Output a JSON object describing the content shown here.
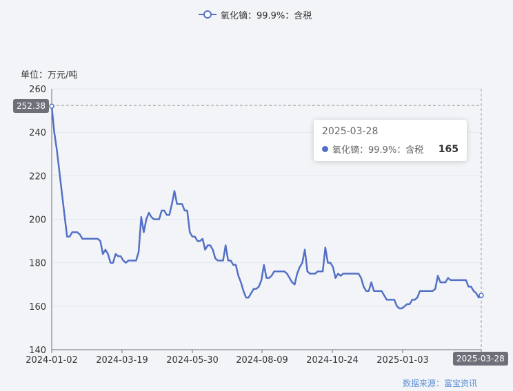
{
  "legend": {
    "label": "氧化镝：99.9%：含税"
  },
  "unit_label": "单位：万元/吨",
  "tooltip": {
    "date": "2025-03-28",
    "series": "氧化镝：99.9%：含税",
    "value": "165"
  },
  "crosshair": {
    "y_label": "252.38",
    "x_label": "2025-03-28"
  },
  "source": "数据来源：富宝资讯",
  "colors": {
    "line": "#5470c6",
    "grid": "#e0e6f1",
    "axis": "#6e7079"
  },
  "chart_data": {
    "type": "line",
    "ylim": [
      140,
      260
    ],
    "yticks": [
      140,
      160,
      180,
      200,
      220,
      240,
      260
    ],
    "x_ticks": [
      "2024-01-02",
      "2024-03-19",
      "2024-05-30",
      "2024-08-09",
      "2024-10-24",
      "2025-01-03",
      "2025-03-28"
    ],
    "series": [
      {
        "name": "氧化镝：99.9%：含税",
        "values": [
          252,
          240,
          232,
          222,
          212,
          202,
          192,
          192,
          194,
          194,
          194,
          193,
          191,
          191,
          191,
          191,
          191,
          191,
          191,
          190,
          184,
          186,
          184,
          180,
          180,
          184,
          183,
          183,
          181,
          180,
          181,
          181,
          181,
          181,
          185,
          201,
          194,
          200,
          203,
          201,
          200,
          200,
          200,
          204,
          204,
          202,
          202,
          207,
          213,
          207,
          207,
          207,
          204,
          204,
          194,
          192,
          192,
          190,
          190,
          191,
          186,
          188,
          188,
          186,
          182,
          181,
          181,
          181,
          188,
          181,
          181,
          179,
          179,
          174,
          171,
          167,
          164,
          164,
          166,
          168,
          168,
          169,
          172,
          179,
          173,
          173,
          174,
          176,
          176,
          176,
          176,
          176,
          175,
          173,
          171,
          170,
          175,
          178,
          180,
          186,
          176,
          175,
          175,
          175,
          176,
          176,
          176,
          187,
          180,
          180,
          178,
          173,
          175,
          174,
          175,
          175,
          175,
          175,
          175,
          175,
          175,
          173,
          169,
          167,
          167,
          171,
          167,
          167,
          167,
          167,
          165,
          163,
          163,
          163,
          163,
          160,
          159,
          159,
          160,
          161,
          161,
          163,
          163,
          164,
          167,
          167,
          167,
          167,
          167,
          167,
          168,
          174,
          171,
          171,
          171,
          173,
          172,
          172,
          172,
          172,
          172,
          172,
          172,
          169,
          169,
          167,
          166,
          164,
          165
        ]
      }
    ]
  }
}
